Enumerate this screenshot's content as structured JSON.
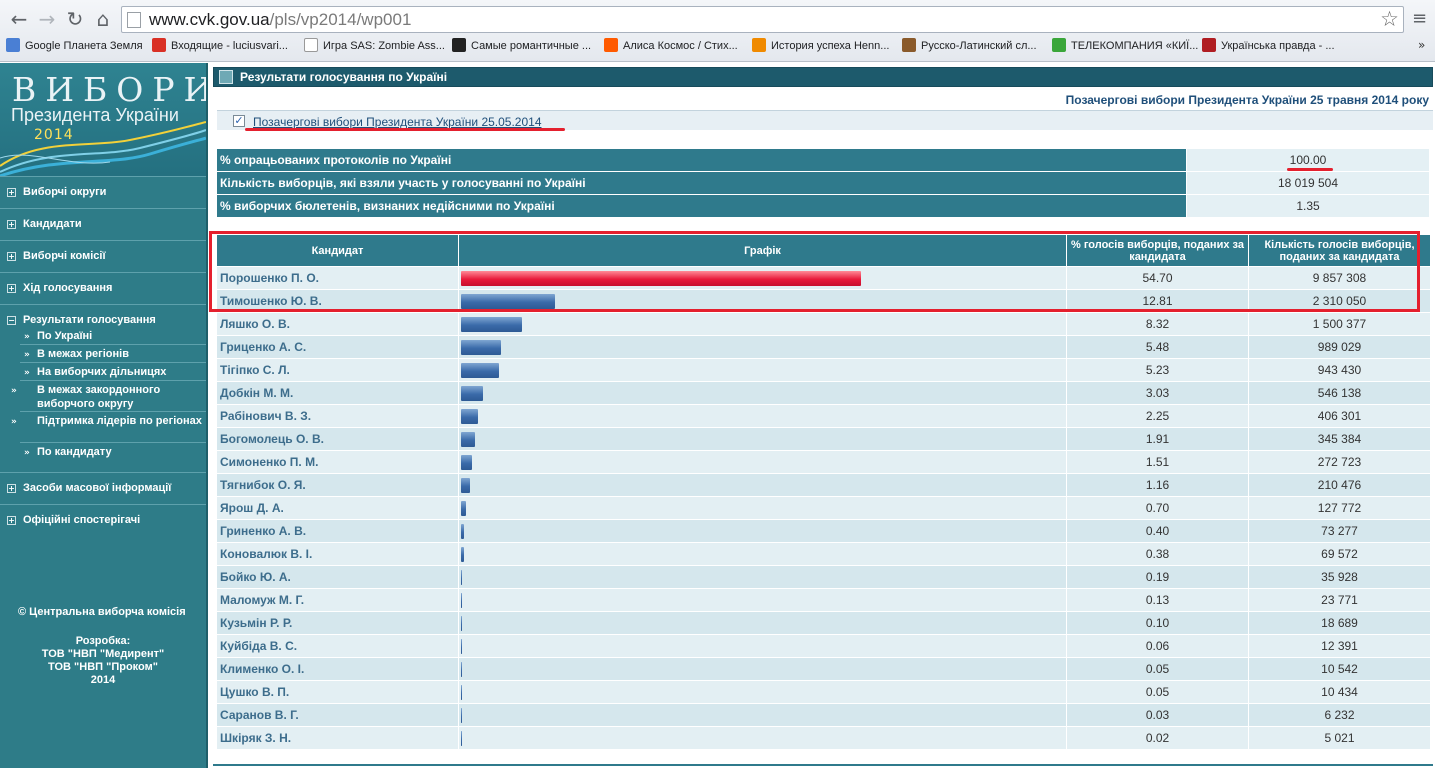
{
  "browser": {
    "url_host": "www.cvk.gov.ua",
    "url_path": "/pls/vp2014/wp001",
    "bookmarks": [
      {
        "label": "Google Планета Земля",
        "color": "#4a7fd4"
      },
      {
        "label": "Входящие - luciusvari...",
        "color": "#d93025"
      },
      {
        "label": "Игра SAS: Zombie Ass...",
        "color": "#ffffff"
      },
      {
        "label": "Самые романтичные ...",
        "color": "#222222"
      },
      {
        "label": "Алиса Космос / Стих...",
        "color": "#ff5a00"
      },
      {
        "label": "История успеха Henn...",
        "color": "#f08a00"
      },
      {
        "label": "Русско-Латинский сл...",
        "color": "#8a5a2b"
      },
      {
        "label": "ТЕЛЕКОМПАНИЯ «КИЇ...",
        "color": "#3aa63a"
      },
      {
        "label": "Українська правда - ...",
        "color": "#b01d22"
      }
    ]
  },
  "sidebar": {
    "logo_title": "ВИБОРИ",
    "logo_subtitle": "Президента України",
    "logo_year": "2014",
    "items": [
      {
        "label": "Виборчі округи"
      },
      {
        "label": "Кандидати"
      },
      {
        "label": "Виборчі комісії"
      },
      {
        "label": "Хід голосування"
      }
    ],
    "results": {
      "label": "Результати голосування",
      "subitems": [
        "По Україні",
        "В межах регіонів",
        "На виборчих дільницях",
        "В межах закордонного виборчого округу",
        "Підтримка лідерів по регіонах",
        "По кандидату"
      ]
    },
    "items2": [
      {
        "label": "Засоби масової інформації"
      },
      {
        "label": "Офіційні спостерігачі"
      }
    ],
    "copyright": "© Центральна виборча комісія",
    "credits": [
      "Розробка:",
      "ТОВ \"НВП \"Медирент\"",
      "ТОВ \"НВП \"Проком\"",
      "2014"
    ]
  },
  "main": {
    "section_title": "Результати голосування по Україні",
    "election_title": "Позачергові вибори Президента України 25 травня 2014 року",
    "sub_link": "Позачергові вибори Президента України 25.05.2014",
    "stats": [
      {
        "label": "% опрацьованих протоколів по Україні",
        "value": "100.00"
      },
      {
        "label": "Кількість виборців, які взяли участь у голосуванні по Україні",
        "value": "18 019 504"
      },
      {
        "label": "% виборчих бюлетенів, визнаних недійсними по Україні",
        "value": "1.35"
      }
    ],
    "columns": {
      "candidate": "Кандидат",
      "graph": "Графік",
      "percent": "% голосів виборців, поданих за кандидата",
      "votes": "Кількість голосів виборців, поданих за кандидата"
    },
    "bar_colors": {
      "leader": "#e81a3b",
      "others": "#3a6aa9"
    },
    "candidates": [
      {
        "name": "Порошенко П. О.",
        "percent": "54.70",
        "votes": "9 857 308"
      },
      {
        "name": "Тимошенко Ю. В.",
        "percent": "12.81",
        "votes": "2 310 050"
      },
      {
        "name": "Ляшко О. В.",
        "percent": "8.32",
        "votes": "1 500 377"
      },
      {
        "name": "Гриценко А. С.",
        "percent": "5.48",
        "votes": "989 029"
      },
      {
        "name": "Тігіпко С. Л.",
        "percent": "5.23",
        "votes": "943 430"
      },
      {
        "name": "Добкін М. М.",
        "percent": "3.03",
        "votes": "546 138"
      },
      {
        "name": "Рабінович В. З.",
        "percent": "2.25",
        "votes": "406 301"
      },
      {
        "name": "Богомолець О. В.",
        "percent": "1.91",
        "votes": "345 384"
      },
      {
        "name": "Симоненко П. М.",
        "percent": "1.51",
        "votes": "272 723"
      },
      {
        "name": "Тягнибок О. Я.",
        "percent": "1.16",
        "votes": "210 476"
      },
      {
        "name": "Ярош Д. А.",
        "percent": "0.70",
        "votes": "127 772"
      },
      {
        "name": "Гриненко А. В.",
        "percent": "0.40",
        "votes": "73 277"
      },
      {
        "name": "Коновалюк В. І.",
        "percent": "0.38",
        "votes": "69 572"
      },
      {
        "name": "Бойко Ю. А.",
        "percent": "0.19",
        "votes": "35 928"
      },
      {
        "name": "Маломуж М. Г.",
        "percent": "0.13",
        "votes": "23 771"
      },
      {
        "name": "Кузьмін Р. Р.",
        "percent": "0.10",
        "votes": "18 689"
      },
      {
        "name": "Куйбіда В. С.",
        "percent": "0.06",
        "votes": "12 391"
      },
      {
        "name": "Клименко О. І.",
        "percent": "0.05",
        "votes": "10 542"
      },
      {
        "name": "Цушко В. П.",
        "percent": "0.05",
        "votes": "10 434"
      },
      {
        "name": "Саранов В. Г.",
        "percent": "0.03",
        "votes": "6 232"
      },
      {
        "name": "Шкіряк З. Н.",
        "percent": "0.02",
        "votes": "5 021"
      }
    ]
  }
}
